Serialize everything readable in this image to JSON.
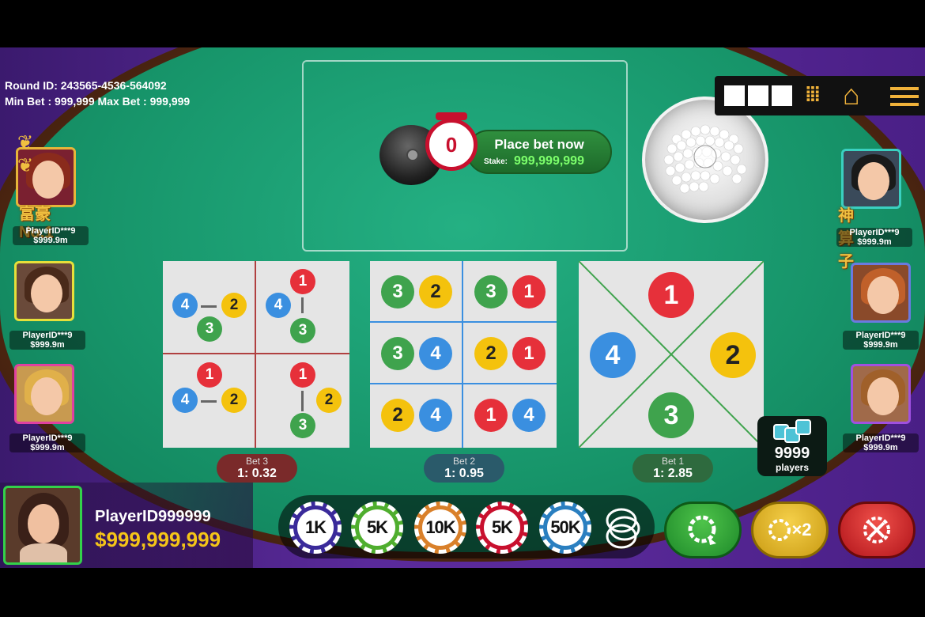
{
  "round": {
    "id_text": "Round ID: 243565-4536-564092",
    "limits_text": "Min Bet : 999,999 Max Bet : 999,999"
  },
  "timer": {
    "value": "0"
  },
  "bet_prompt": {
    "title": "Place bet now",
    "stake_label": "Stake:",
    "stake_value": "999,999,999"
  },
  "players_left": [
    {
      "name": "PlayerID***9",
      "amount": "$999.9m",
      "tag": "富豪No.1"
    },
    {
      "name": "PlayerID***9",
      "amount": "$999.9m"
    },
    {
      "name": "PlayerID***9",
      "amount": "$999.9m"
    }
  ],
  "players_right": [
    {
      "name": "PlayerID***9",
      "amount": "$999.9m",
      "tag": "神算子"
    },
    {
      "name": "PlayerID***9",
      "amount": "$999.9m"
    },
    {
      "name": "PlayerID***9",
      "amount": "$999.9m"
    }
  ],
  "bet3_panel": {
    "cells": [
      {
        "balls": [
          "4",
          "2",
          "3"
        ]
      },
      {
        "balls": [
          "1",
          "4",
          "3"
        ]
      },
      {
        "balls": [
          "1",
          "4",
          "2"
        ]
      },
      {
        "balls": [
          "1",
          "2",
          "3"
        ]
      }
    ]
  },
  "bet2_panel": {
    "cells": [
      [
        "3",
        "2"
      ],
      [
        "3",
        "1"
      ],
      [
        "3",
        "4"
      ],
      [
        "2",
        "1"
      ],
      [
        "2",
        "4"
      ],
      [
        "1",
        "4"
      ]
    ]
  },
  "bet1_panel": {
    "top": "1",
    "left": "4",
    "right": "2",
    "bottom": "3"
  },
  "odds": [
    {
      "bet": "Bet 3",
      "ratio": "1: 0.32"
    },
    {
      "bet": "Bet 2",
      "ratio": "1: 0.95"
    },
    {
      "bet": "Bet 1",
      "ratio": "1: 2.85"
    }
  ],
  "players_count": {
    "number": "9999",
    "label": "players"
  },
  "me": {
    "name": "PlayerID999999",
    "balance": "$999,999,999"
  },
  "chips": [
    {
      "label": "1K",
      "color": "#3a2a9a"
    },
    {
      "label": "5K",
      "color": "#4fae2e"
    },
    {
      "label": "10K",
      "color": "#d9802a"
    },
    {
      "label": "5K",
      "color": "#c8102e"
    },
    {
      "label": "50K",
      "color": "#2a7fc0"
    }
  ],
  "actions": {
    "rebet_label": "",
    "double_label": "×2",
    "cancel_label": ""
  },
  "icons": {
    "home": "home-icon",
    "menu": "menu-icon",
    "grid": "grid-icon",
    "stack": "chip-stack-icon",
    "rebet": "rebet-icon",
    "double": "double-icon",
    "cancel": "cancel-icon"
  },
  "colors": {
    "felt": "#17956a",
    "accent_gold": "#f5c518",
    "ball_red": "#e6303a",
    "ball_yellow": "#f4c20d",
    "ball_green": "#3fa34d",
    "ball_blue": "#3a8fe0"
  }
}
